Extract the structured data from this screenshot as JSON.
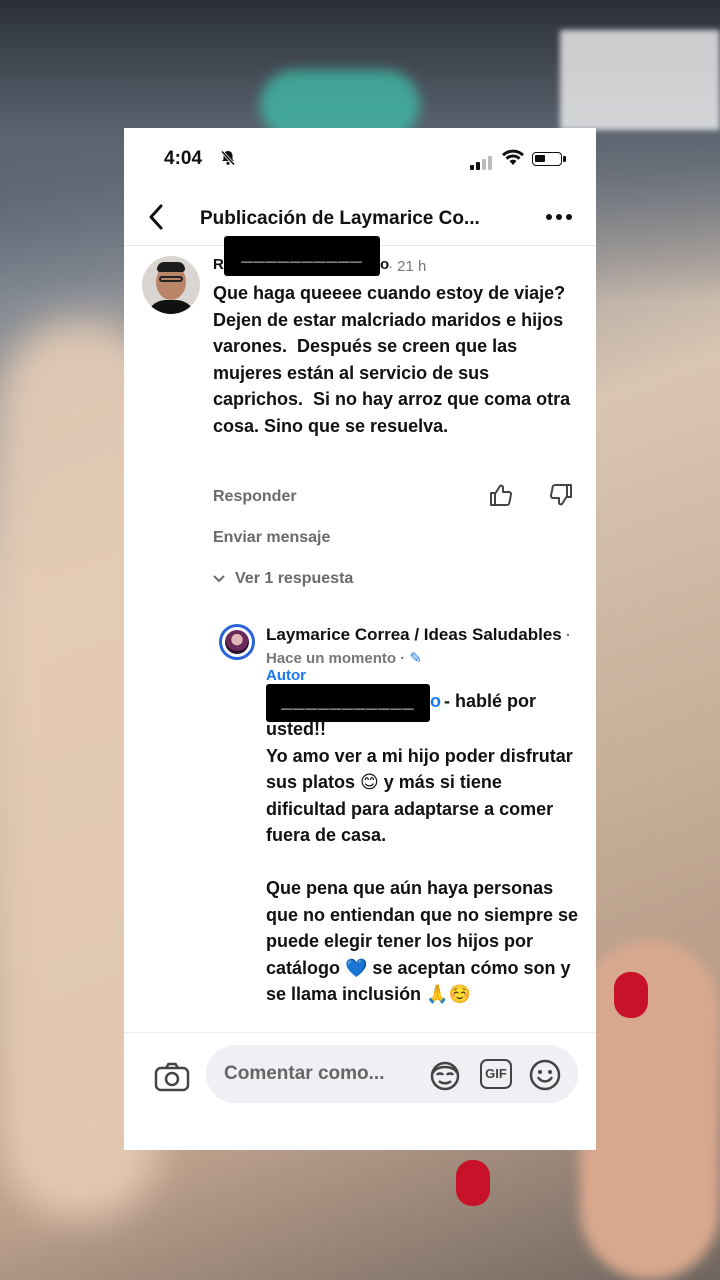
{
  "status_bar": {
    "time": "4:04",
    "mute_icon": "bell-slash-icon"
  },
  "header": {
    "title": "Publicación de Laymarice Co..."
  },
  "comment": {
    "author_initial": "R",
    "author_redacted": "__________",
    "author_last_char": "o",
    "time_ago": "21 h",
    "text": "Que haga queeee cuando estoy de viaje?  Dejen de estar malcriado maridos e hijos varones.  Después se creen que las mujeres están al servicio de sus caprichos.  Si no hay arroz que coma otra cosa. Sino que se resuelva.",
    "reply_label": "Responder",
    "message_label": "Enviar mensaje",
    "view_replies_label": "Ver 1 respuesta"
  },
  "reply": {
    "author": "Laymarice Correa / Ideas Saludables",
    "meta": " · Hace un momento · ",
    "badge": "Autor",
    "mention_redacted": "___________",
    "mention_tail": "o",
    "first_line": " - hablé por",
    "text": "usted!!\nYo amo ver a mi hijo poder disfrutar sus platos 😊 y más si tiene dificultad para adaptarse a comer fuera de casa.\n\nQue pena que aún haya personas que no entiendan que no siempre se puede elegir tener los hijos por catálogo 💙 se aceptan cómo son y se llama inclusión 🙏☺️"
  },
  "composer": {
    "placeholder": "Comentar como...",
    "gif_label": "GIF"
  },
  "colors": {
    "link_blue": "#1877f2",
    "muted_gray": "#6a6a6a",
    "text": "#111111"
  }
}
